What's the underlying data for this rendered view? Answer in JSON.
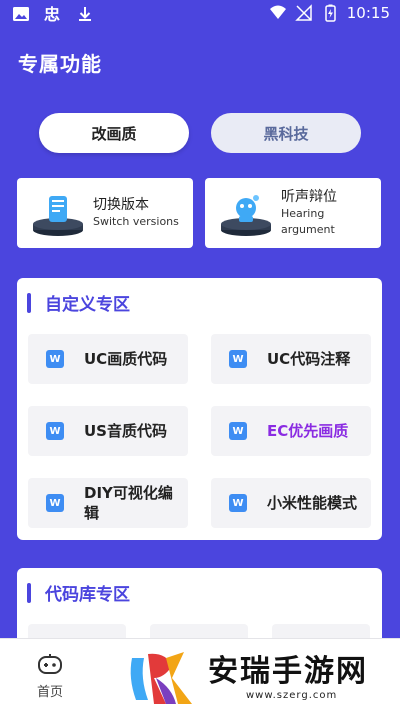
{
  "status_bar": {
    "time": "10:15"
  },
  "page_title": "专属功能",
  "mode_buttons": [
    {
      "label": "改画质",
      "active": true
    },
    {
      "label": "黑科技",
      "active": false
    }
  ],
  "feature_cards": [
    {
      "title": "切换版本",
      "subtitle": "Switch versions",
      "icon": "phone-stand-icon"
    },
    {
      "title": "听声辩位",
      "subtitle": "Hearing argument",
      "icon": "robot-stand-icon"
    }
  ],
  "custom_section": {
    "title": "自定义专区",
    "items": [
      {
        "label": "UC画质代码",
        "accent": false
      },
      {
        "label": "UC代码注释",
        "accent": false
      },
      {
        "label": "US音质代码",
        "accent": false
      },
      {
        "label": "EC优先画质",
        "accent": true
      },
      {
        "label": "DIY可视化编辑",
        "accent": false
      },
      {
        "label": "小米性能模式",
        "accent": false
      }
    ],
    "item_icon": "W"
  },
  "library_section": {
    "title": "代码库专区"
  },
  "bottom_nav": {
    "home_label": "首页"
  },
  "watermark": {
    "brand": "安瑞手游网",
    "url": "www.szerg.com"
  },
  "colors": {
    "accent": "#4B45DE",
    "highlight_text": "#8A2BE2",
    "card_bg": "#FFFFFF",
    "item_bg": "#F3F3F6"
  }
}
